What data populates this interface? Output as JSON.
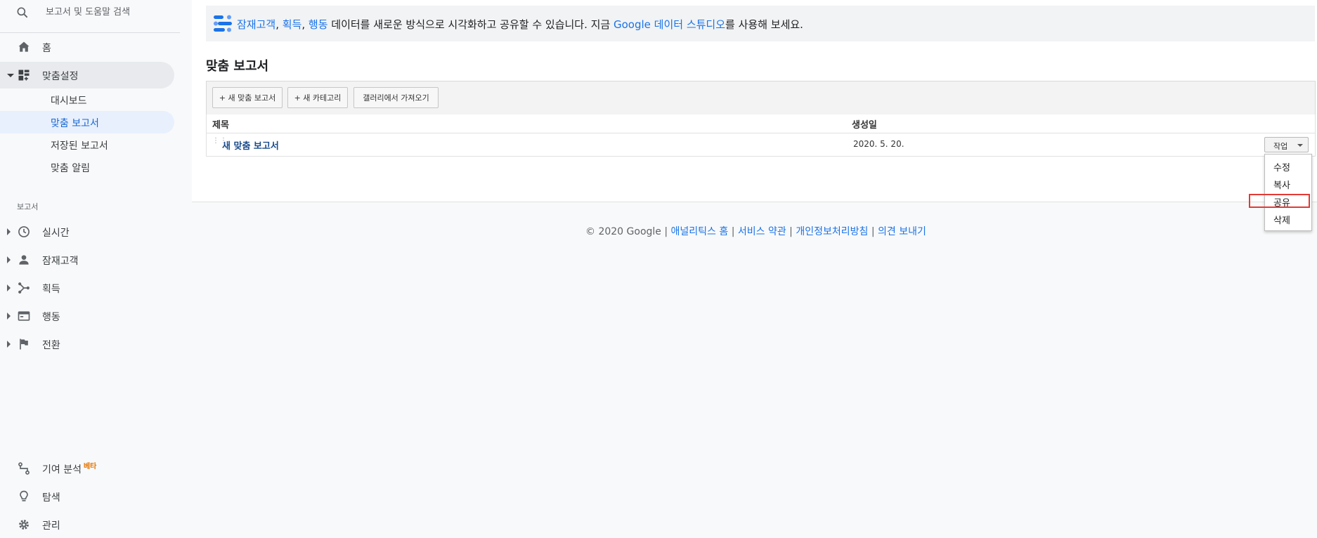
{
  "sidebar": {
    "search_placeholder": "보고서 및 도움말 검색",
    "home": "홈",
    "customization": "맞춤설정",
    "sub_items": [
      "대시보드",
      "맞춤 보고서",
      "저장된 보고서",
      "맞춤 알림"
    ],
    "reports_section": "보고서",
    "reports": [
      "실시간",
      "잠재고객",
      "획득",
      "행동",
      "전환"
    ],
    "attribution": "기여 분석",
    "beta_badge": "베타",
    "discover": "탐색",
    "admin": "관리"
  },
  "banner": {
    "link_audience": "잠재고객",
    "sep1": ", ",
    "link_acquisition": "획득",
    "sep2": ", ",
    "link_behavior": "행동",
    "text_mid": " 데이터를 새로운 방식으로 시각화하고 공유할 수 있습니다. 지금 ",
    "link_ds": "Google 데이터 스튜디오",
    "text_end": "를 사용해 보세요."
  },
  "page_title": "맞춤 보고서",
  "toolbar": {
    "new_report": "+ 새 맞춤 보고서",
    "new_category": "+ 새 카테고리",
    "import_gallery": "갤러리에서 가져오기"
  },
  "table": {
    "col_title": "제목",
    "col_created": "생성일",
    "rows": [
      {
        "title": "새 맞춤 보고서",
        "created": "2020. 5. 20."
      }
    ]
  },
  "action_button": "작업",
  "action_menu": [
    "수정",
    "복사",
    "공유",
    "삭제"
  ],
  "footer": {
    "copyright": "© 2020 Google | ",
    "links": [
      "애널리틱스 홈",
      "서비스 약관",
      "개인정보처리방침",
      "의견 보내기"
    ],
    "separator": " | "
  },
  "colors": {
    "accent": "#1a73e8",
    "highlight_box": "#e53935",
    "beta": "#e37400"
  }
}
